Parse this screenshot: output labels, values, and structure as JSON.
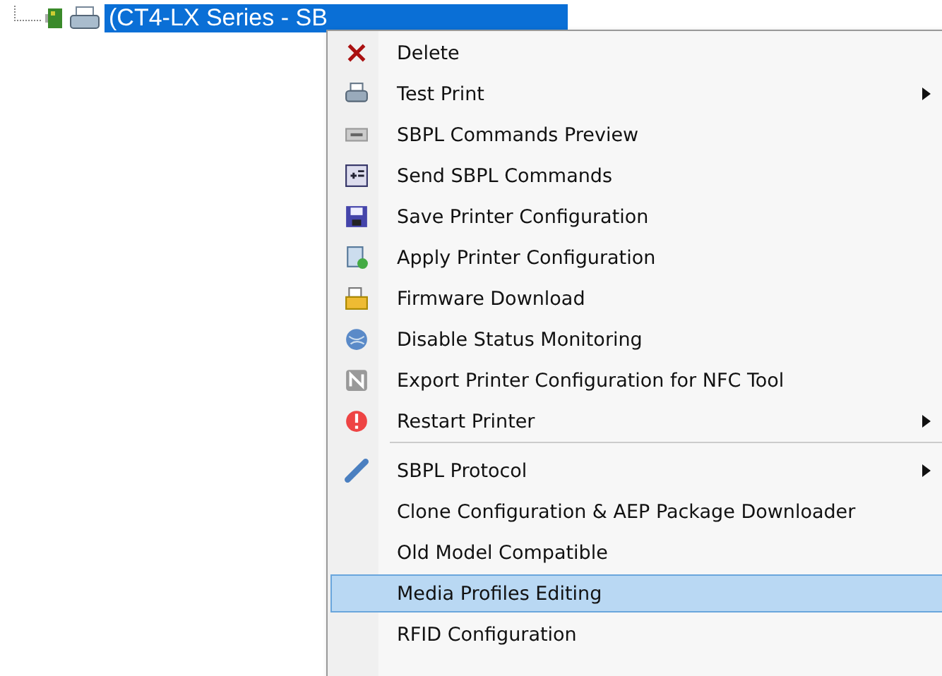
{
  "tree": {
    "node": {
      "label": "(CT4-LX Series - SB",
      "selected": true
    }
  },
  "context_menu": {
    "items": [
      {
        "kind": "item",
        "label": "Delete",
        "submenu": false,
        "selected": false
      },
      {
        "kind": "item",
        "label": "Test Print",
        "submenu": true,
        "selected": false
      },
      {
        "kind": "item",
        "label": "SBPL Commands Preview",
        "submenu": false,
        "selected": false
      },
      {
        "kind": "item",
        "label": "Send SBPL Commands",
        "submenu": false,
        "selected": false
      },
      {
        "kind": "item",
        "label": "Save Printer Configuration",
        "submenu": false,
        "selected": false
      },
      {
        "kind": "item",
        "label": "Apply Printer Configuration",
        "submenu": false,
        "selected": false
      },
      {
        "kind": "item",
        "label": "Firmware Download",
        "submenu": false,
        "selected": false
      },
      {
        "kind": "item",
        "label": "Disable Status Monitoring",
        "submenu": false,
        "selected": false
      },
      {
        "kind": "item",
        "label": "Export Printer Configuration for NFC Tool",
        "submenu": false,
        "selected": false
      },
      {
        "kind": "item",
        "label": "Restart Printer",
        "submenu": true,
        "selected": false
      },
      {
        "kind": "separator"
      },
      {
        "kind": "item",
        "label": "SBPL Protocol",
        "submenu": true,
        "selected": false
      },
      {
        "kind": "item",
        "label": "Clone Configuration & AEP Package Downloader",
        "submenu": false,
        "selected": false
      },
      {
        "kind": "item",
        "label": "Old Model Compatible",
        "submenu": false,
        "selected": false
      },
      {
        "kind": "item",
        "label": "Media Profiles Editing",
        "submenu": false,
        "selected": true
      },
      {
        "kind": "item",
        "label": "RFID Configuration",
        "submenu": false,
        "selected": false
      }
    ]
  }
}
